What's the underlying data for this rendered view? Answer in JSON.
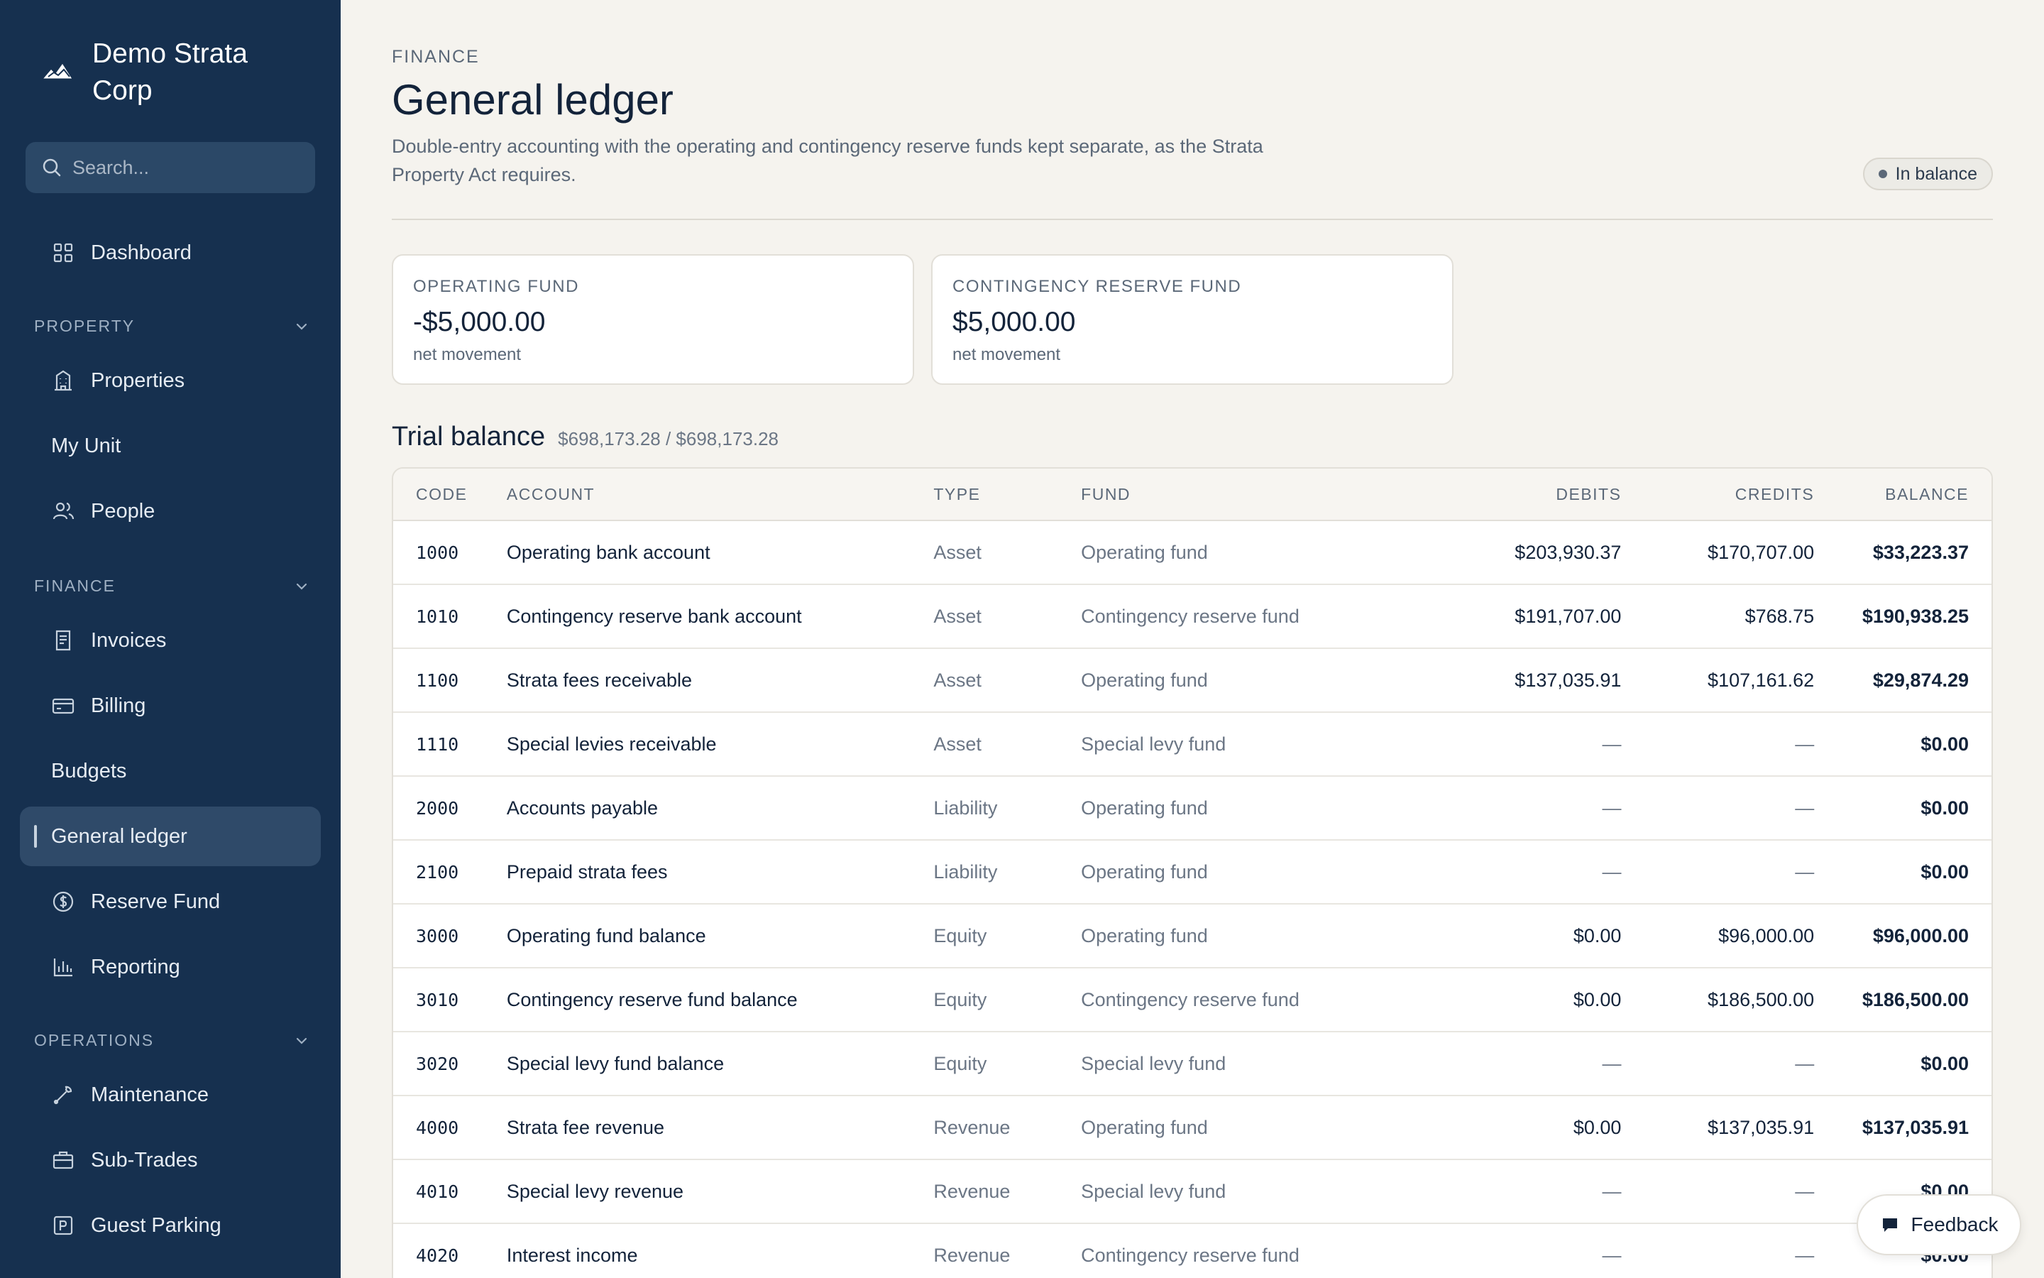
{
  "sidebar": {
    "brand": "Demo Strata Corp",
    "search_placeholder": "Search...",
    "dashboard": "Dashboard",
    "sections": {
      "property": "PROPERTY",
      "finance": "FINANCE",
      "operations": "OPERATIONS"
    },
    "items": {
      "properties": "Properties",
      "my_unit": "My Unit",
      "people": "People",
      "invoices": "Invoices",
      "billing": "Billing",
      "budgets": "Budgets",
      "general_ledger": "General ledger",
      "reserve_fund": "Reserve Fund",
      "reporting": "Reporting",
      "maintenance": "Maintenance",
      "sub_trades": "Sub-Trades",
      "guest_parking": "Guest Parking"
    }
  },
  "header": {
    "eyebrow": "FINANCE",
    "title": "General ledger",
    "description": "Double-entry accounting with the operating and contingency reserve funds kept separate, as the Strata Property Act requires.",
    "status_badge": "In balance"
  },
  "funds": [
    {
      "label": "OPERATING FUND",
      "value": "-$5,000.00",
      "sub": "net movement"
    },
    {
      "label": "CONTINGENCY RESERVE FUND",
      "value": "$5,000.00",
      "sub": "net movement"
    }
  ],
  "trial_balance": {
    "title": "Trial balance",
    "totals": "$698,173.28 / $698,173.28",
    "columns": {
      "code": "CODE",
      "account": "ACCOUNT",
      "type": "TYPE",
      "fund": "FUND",
      "debits": "DEBITS",
      "credits": "CREDITS",
      "balance": "BALANCE"
    },
    "rows": [
      {
        "code": "1000",
        "account": "Operating bank account",
        "type": "Asset",
        "fund": "Operating fund",
        "debits": "$203,930.37",
        "credits": "$170,707.00",
        "balance": "$33,223.37"
      },
      {
        "code": "1010",
        "account": "Contingency reserve bank account",
        "type": "Asset",
        "fund": "Contingency reserve fund",
        "debits": "$191,707.00",
        "credits": "$768.75",
        "balance": "$190,938.25"
      },
      {
        "code": "1100",
        "account": "Strata fees receivable",
        "type": "Asset",
        "fund": "Operating fund",
        "debits": "$137,035.91",
        "credits": "$107,161.62",
        "balance": "$29,874.29"
      },
      {
        "code": "1110",
        "account": "Special levies receivable",
        "type": "Asset",
        "fund": "Special levy fund",
        "debits": "—",
        "credits": "—",
        "balance": "$0.00"
      },
      {
        "code": "2000",
        "account": "Accounts payable",
        "type": "Liability",
        "fund": "Operating fund",
        "debits": "—",
        "credits": "—",
        "balance": "$0.00"
      },
      {
        "code": "2100",
        "account": "Prepaid strata fees",
        "type": "Liability",
        "fund": "Operating fund",
        "debits": "—",
        "credits": "—",
        "balance": "$0.00"
      },
      {
        "code": "3000",
        "account": "Operating fund balance",
        "type": "Equity",
        "fund": "Operating fund",
        "debits": "$0.00",
        "credits": "$96,000.00",
        "balance": "$96,000.00"
      },
      {
        "code": "3010",
        "account": "Contingency reserve fund balance",
        "type": "Equity",
        "fund": "Contingency reserve fund",
        "debits": "$0.00",
        "credits": "$186,500.00",
        "balance": "$186,500.00"
      },
      {
        "code": "3020",
        "account": "Special levy fund balance",
        "type": "Equity",
        "fund": "Special levy fund",
        "debits": "—",
        "credits": "—",
        "balance": "$0.00"
      },
      {
        "code": "4000",
        "account": "Strata fee revenue",
        "type": "Revenue",
        "fund": "Operating fund",
        "debits": "$0.00",
        "credits": "$137,035.91",
        "balance": "$137,035.91"
      },
      {
        "code": "4010",
        "account": "Special levy revenue",
        "type": "Revenue",
        "fund": "Special levy fund",
        "debits": "—",
        "credits": "—",
        "balance": "$0.00"
      },
      {
        "code": "4020",
        "account": "Interest income",
        "type": "Revenue",
        "fund": "Contingency reserve fund",
        "debits": "—",
        "credits": "—",
        "balance": "$0.00"
      }
    ]
  },
  "feedback_label": "Feedback",
  "colors": {
    "sidebar_bg": "#16304f",
    "active_item_bg": "#2f4a69",
    "page_bg": "#f5f3ee",
    "text_primary": "#13233a"
  }
}
